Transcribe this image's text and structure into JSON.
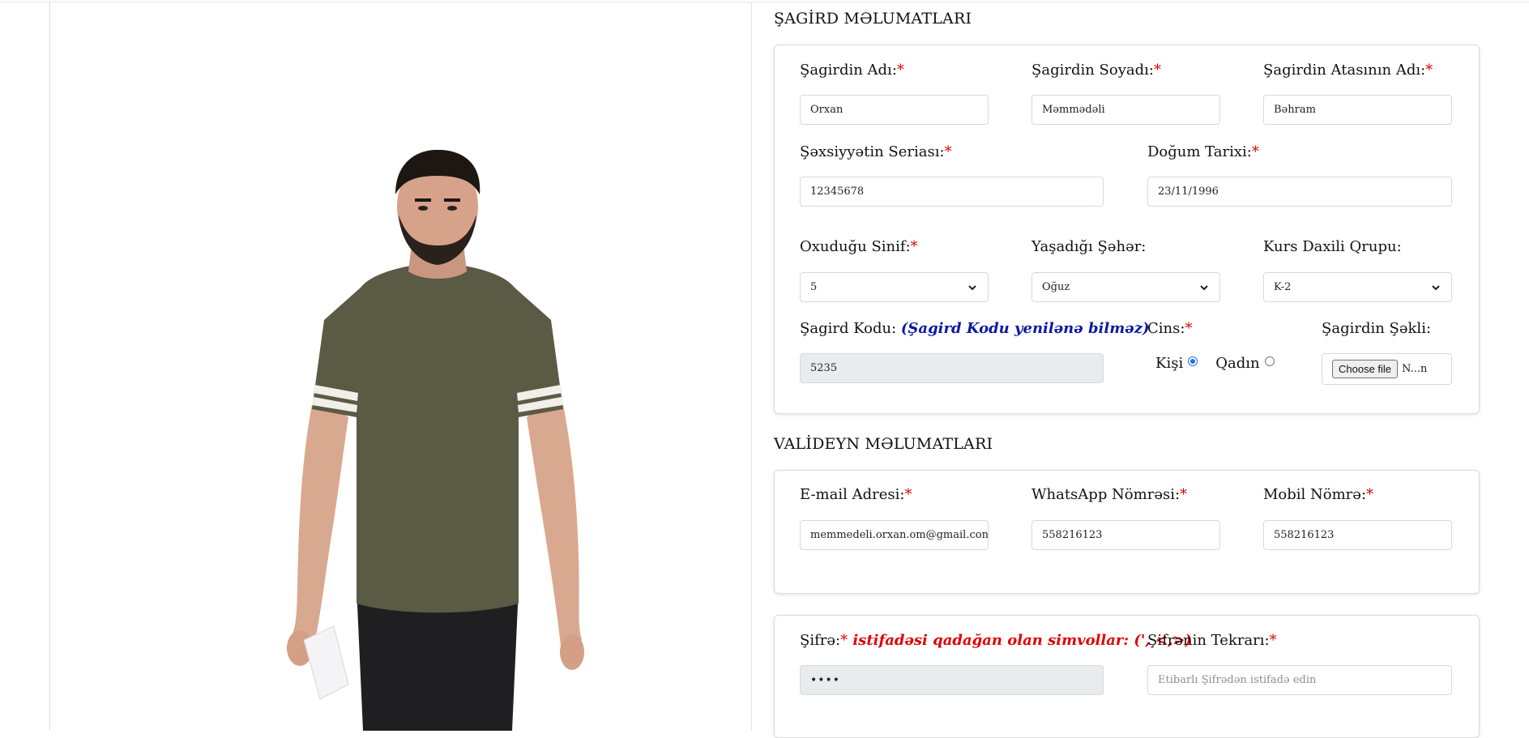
{
  "student_section": {
    "title": "ŞAGİRD MƏLUMATLARI",
    "first_name": {
      "label": "Şagirdin Adı:",
      "required": "*",
      "value": "Orxan"
    },
    "last_name": {
      "label": "Şagirdin Soyadı:",
      "required": "*",
      "value": "Məmmədəli"
    },
    "father_name": {
      "label": "Şagirdin Atasının Adı:",
      "required": "*",
      "value": "Bəhram"
    },
    "id_series": {
      "label": "Şəxsiyyətin Seriası:",
      "required": "*",
      "value": "12345678"
    },
    "birth_date": {
      "label": "Doğum Tarixi:",
      "required": "*",
      "value": "23/11/1996"
    },
    "grade": {
      "label": "Oxuduğu Sinif:",
      "required": "*",
      "value": "5"
    },
    "city": {
      "label": "Yaşadığı Şəhər:",
      "value": "Oğuz"
    },
    "group": {
      "label": "Kurs Daxili Qrupu:",
      "value": "K-2"
    },
    "student_code": {
      "label": "Şagird Kodu:",
      "note": "(Şagird Kodu yenilənə bilməz)",
      "value": "5235"
    },
    "gender": {
      "label": "Cins:",
      "required": "*",
      "male": "Kişi",
      "female": "Qadın",
      "selected": "male"
    },
    "photo": {
      "label": "Şagirdin Şəkli:",
      "button": "Choose file",
      "file_name": "N...n"
    }
  },
  "parent_section": {
    "title": "VALİDEYN MƏLUMATLARI",
    "email": {
      "label": "E-mail Adresi:",
      "required": "*",
      "value": "memmedeli.orxan.om@gmail.con"
    },
    "whatsapp": {
      "label": "WhatsApp Nömrəsi:",
      "required": "*",
      "value": "558216123"
    },
    "mobile": {
      "label": "Mobil Nömrə:",
      "required": "*",
      "value": "558216123"
    }
  },
  "password_section": {
    "password": {
      "label": "Şifrə:",
      "required": "*",
      "note": " istifadəsi qadağan olan simvollar: (', <,>)",
      "value": "••••"
    },
    "password_repeat": {
      "label": "Şifrənin Tekrarı:",
      "required": "*",
      "placeholder": "Etibarlı Şifrədən istifadə edin"
    }
  },
  "colors": {
    "required": "#e00000",
    "note_blue": "#0a1aa0",
    "radio_selected": "#1a73e8",
    "shirt": "#5b5a44",
    "jeans": "#1f1f22"
  },
  "icons": {
    "select_chevron": "chevron-down-icon"
  }
}
